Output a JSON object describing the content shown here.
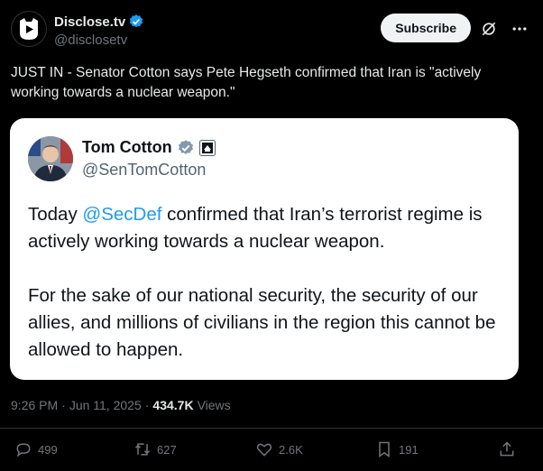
{
  "author": {
    "name": "Disclose.tv",
    "handle": "@disclosetv",
    "verified": true
  },
  "header": {
    "subscribe_label": "Subscribe"
  },
  "tweet": {
    "text": "JUST IN - Senator Cotton says Pete Hegseth confirmed that Iran is \"actively working towards a nuclear weapon.\""
  },
  "quoted": {
    "name": "Tom Cotton",
    "handle": "@SenTomCotton",
    "body_line1_pre": "Today ",
    "body_line1_mention": "@SecDef",
    "body_line1_post": " confirmed that Iran’s terrorist regime is actively working towards a nuclear weapon.",
    "body_para2": "For the sake of our national security, the security of our allies, and millions of civilians in the region this cannot be allowed to happen."
  },
  "meta": {
    "time": "9:26 PM",
    "separator": "·",
    "date": "Jun 11, 2025",
    "separator2": "·",
    "views_count": "434.7K",
    "views_label": "Views"
  },
  "actions": {
    "replies": "499",
    "reposts": "627",
    "likes": "2.6K",
    "bookmarks": "191"
  },
  "colors": {
    "background": "#000000",
    "accent": "#1d9bf0",
    "verified": "#1d9bf0",
    "gov_badge": "#829aab"
  }
}
